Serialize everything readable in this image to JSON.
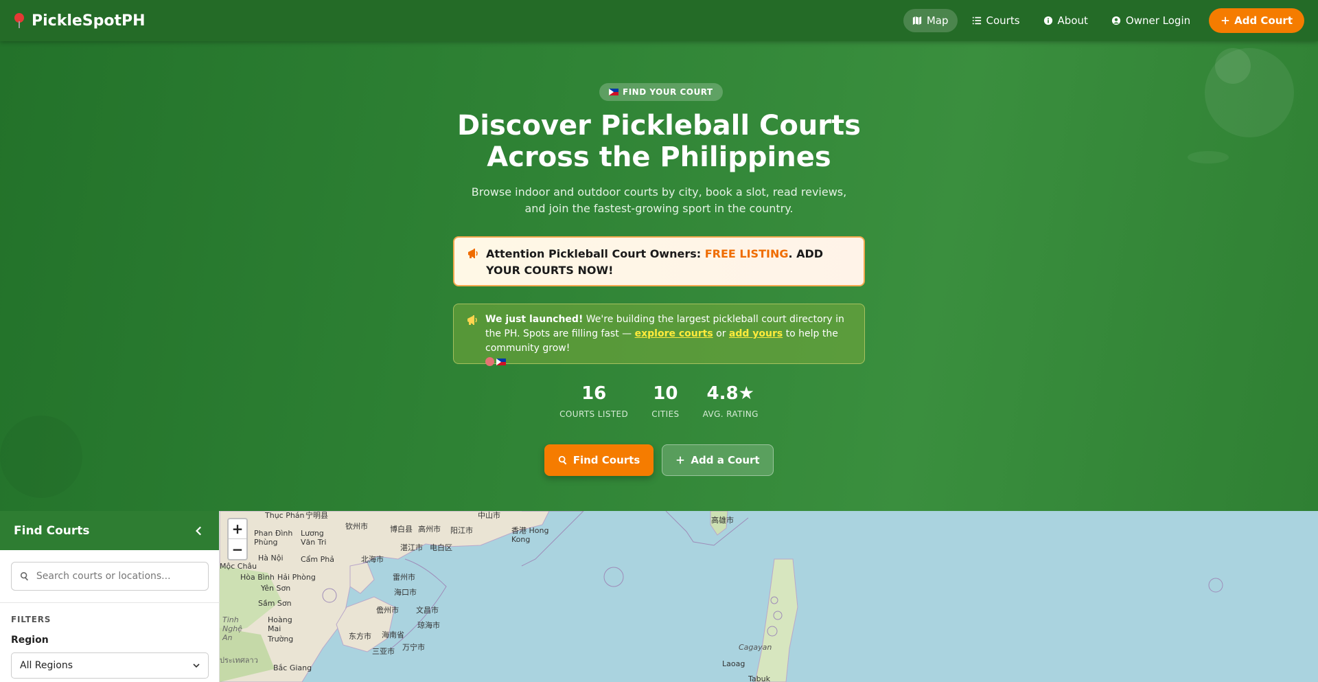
{
  "nav": {
    "brand": "PickleSpotPH",
    "links": [
      {
        "label": "Map",
        "icon": "map-icon",
        "active": true
      },
      {
        "label": "Courts",
        "icon": "list-icon"
      },
      {
        "label": "About",
        "icon": "info-icon"
      },
      {
        "label": "Owner Login",
        "icon": "user-circle-icon"
      }
    ],
    "cta": "Add Court"
  },
  "hero": {
    "pill": "FIND YOUR COURT",
    "title_line1": "Discover Pickleball Courts",
    "title_line2": "Across the Philippines",
    "subtitle": "Browse indoor and outdoor courts by city, book a slot, read reviews, and join the fastest-growing sport in the country.",
    "notice_owner": {
      "prefix": "Attention Pickleball Court Owners: ",
      "highlight": "FREE LISTING",
      "suffix": ". ADD YOUR COURTS NOW!"
    },
    "notice_launch": {
      "bold": "We just launched!",
      "text1": " We're building the largest pickleball court directory in the PH. Spots are filling fast — ",
      "link1": "explore courts",
      "text2": " or ",
      "link2": "add yours",
      "text3": " to help the community grow!"
    },
    "stats": [
      {
        "value": "16",
        "label": "COURTS LISTED"
      },
      {
        "value": "10",
        "label": "CITIES"
      },
      {
        "value": "4.8★",
        "label": "AVG. RATING"
      }
    ],
    "btn_find": "Find Courts",
    "btn_add": "Add a Court"
  },
  "sidebar": {
    "title": "Find Courts",
    "search_placeholder": "Search courts or locations...",
    "filters_label": "FILTERS",
    "region_label": "Region",
    "region_value": "All Regions"
  },
  "map": {
    "zoom_in": "+",
    "zoom_out": "−",
    "labels": [
      "Thục Phán",
      "宁明县",
      "钦州市",
      "博白县",
      "高州市",
      "阳江市",
      "中山市",
      "香港 Hong Kong",
      "高雄市",
      "Phan Đình Phùng",
      "Lương Văn Tri",
      "湛江市",
      "电白区",
      "Hà Nội",
      "Cẩm Phả",
      "北海市",
      "Mộc Châu",
      "Hòa Bình",
      "Hải Phòng",
      "雷州市",
      "Yên Sơn",
      "海口市",
      "Sầm Sơn",
      "儋州市",
      "文昌市",
      "Hoàng Mai",
      "琼海市",
      "东方市",
      "Trường",
      "海南省",
      "万宁市",
      "三亚市",
      "Bắc Giang",
      "Cagayan",
      "Laoag",
      "Tabuk",
      "Tinh Nghệ An",
      "ประเทศลาว"
    ]
  },
  "colors": {
    "brand_green": "#2e7d32",
    "accent_orange": "#f57c00",
    "highlight_orange": "#ef6c00",
    "link_yellow": "#ffeb3b",
    "map_water": "#aad3df"
  }
}
